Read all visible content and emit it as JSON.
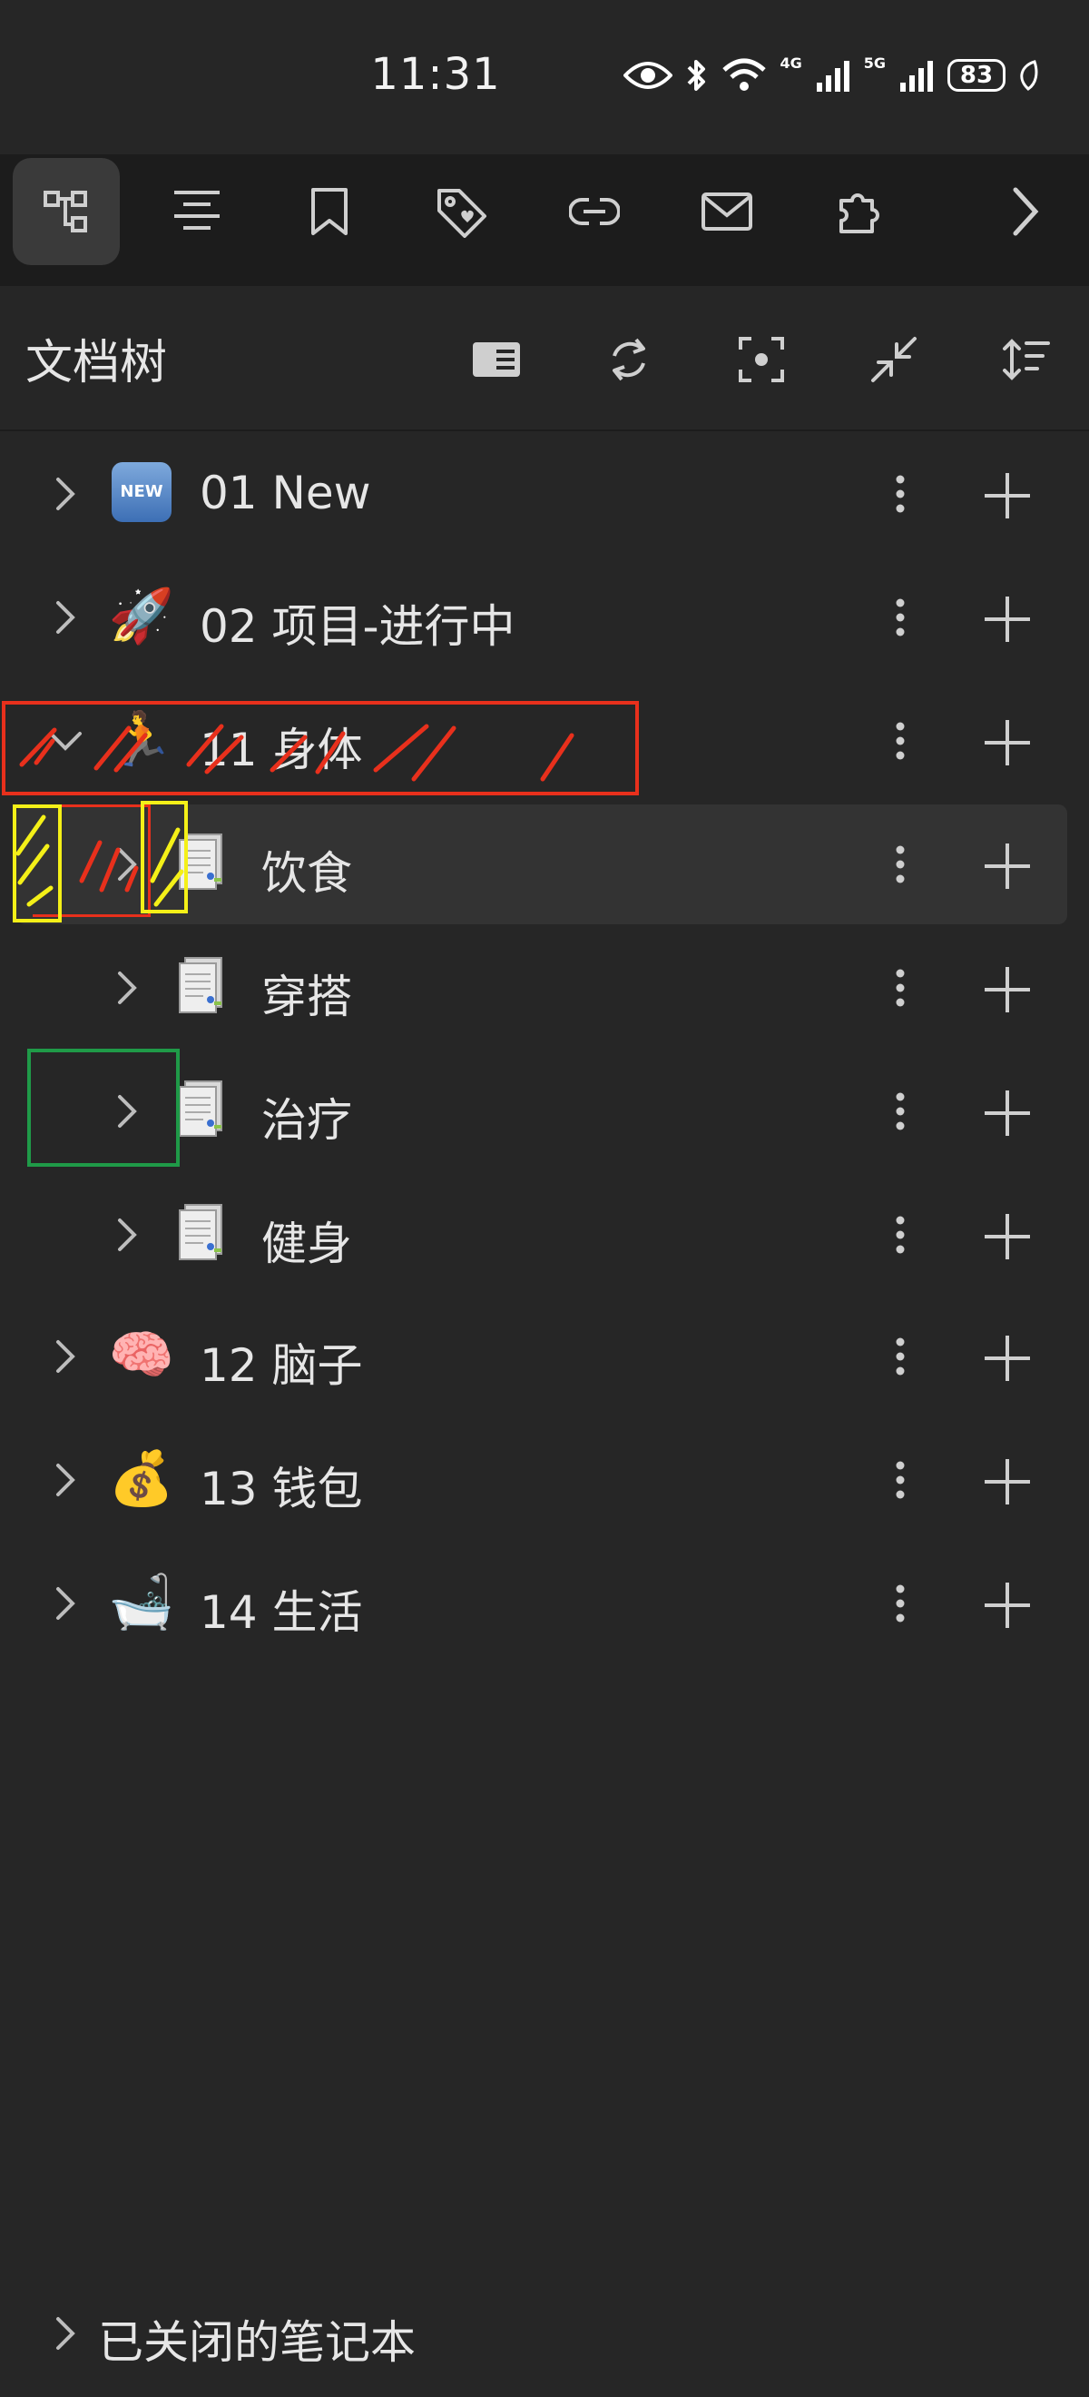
{
  "status_bar": {
    "time": "11:31",
    "network_1": "4G",
    "network_2": "5G",
    "battery": "83"
  },
  "toolbar": {
    "icons": [
      "doc-tree-icon",
      "outline-icon",
      "bookmark-icon",
      "tag-icon",
      "backlink-icon",
      "inbox-icon",
      "plugin-icon",
      "chevron-right-icon"
    ]
  },
  "header": {
    "title": "文档树"
  },
  "tree": {
    "rows": [
      {
        "label": "01 New",
        "emoji": "NEW",
        "level": 0,
        "expanded": false
      },
      {
        "label": "02 项目-进行中",
        "emoji": "🚀",
        "level": 0,
        "expanded": false
      },
      {
        "label": "11 身体",
        "emoji": "🏃",
        "level": 0,
        "expanded": true
      },
      {
        "label": "饮食",
        "emoji": "document",
        "level": 1,
        "expanded": false,
        "selected": true
      },
      {
        "label": "穿搭",
        "emoji": "document",
        "level": 1,
        "expanded": false
      },
      {
        "label": "治疗",
        "emoji": "document",
        "level": 1,
        "expanded": false
      },
      {
        "label": "健身",
        "emoji": "document",
        "level": 1,
        "expanded": false
      },
      {
        "label": "12 脑子",
        "emoji": "🧠",
        "level": 0,
        "expanded": false
      },
      {
        "label": "13 钱包",
        "emoji": "💰",
        "level": 0,
        "expanded": false
      },
      {
        "label": "14 生活",
        "emoji": "🛁",
        "level": 0,
        "expanded": false
      }
    ]
  },
  "closed_notebooks": {
    "label": "已关闭的笔记本"
  },
  "colors": {
    "background": "#262626",
    "toolbar": "#1c1c1c",
    "selected_row": "#333333",
    "annotation_red": "#e8301c",
    "annotation_yellow": "#f4f018",
    "annotation_green": "#1f9a48"
  }
}
